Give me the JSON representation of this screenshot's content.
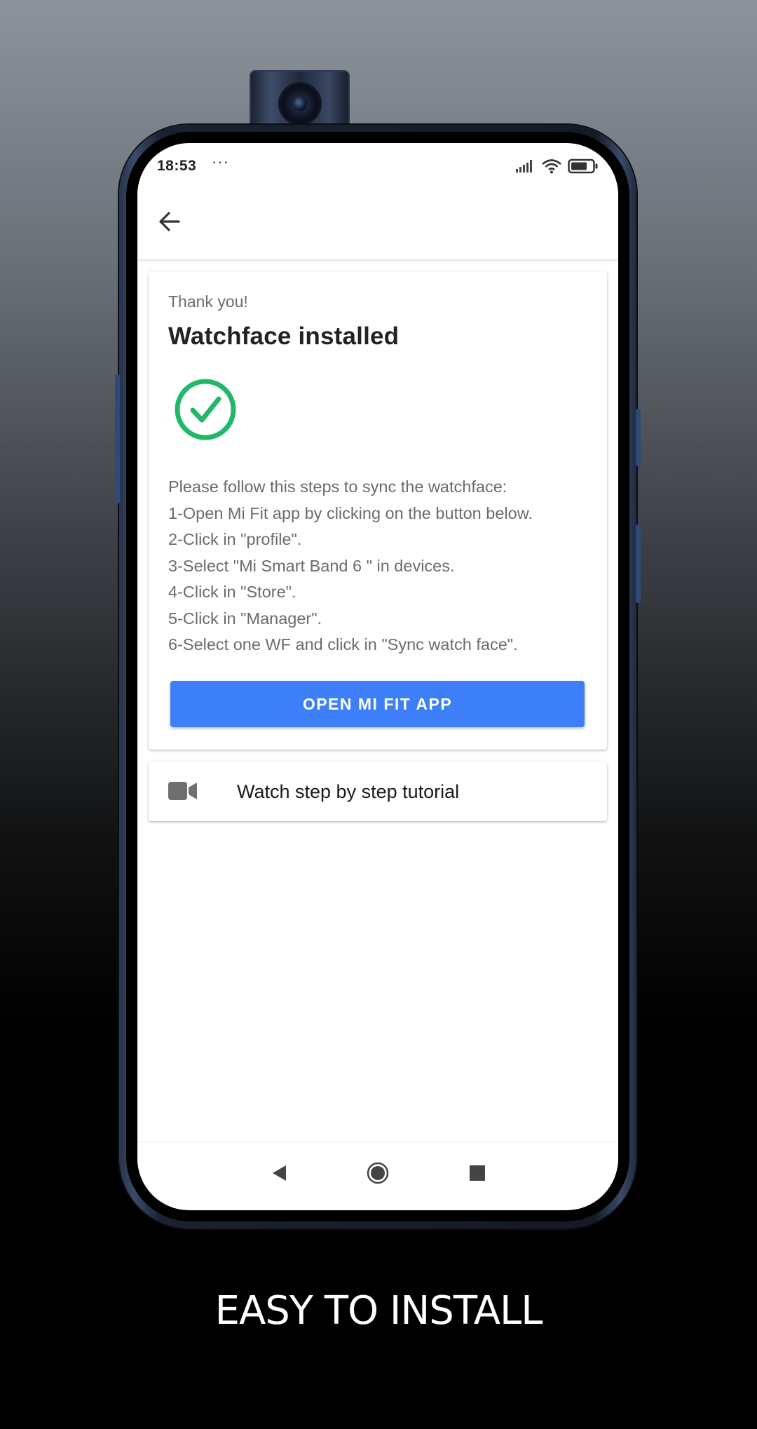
{
  "status_bar": {
    "time": "18:53",
    "dots": "···",
    "icons": [
      "signal-icon",
      "wifi-icon",
      "battery-icon"
    ]
  },
  "app_bar": {
    "back_icon": "arrow-left-icon"
  },
  "install_card": {
    "overline": "Thank you!",
    "title": "Watchface installed",
    "status_icon": "check-circle-icon",
    "status_color": "#21b86a",
    "steps": [
      "Please follow this steps to sync the watchface:",
      "1-Open Mi Fit app by clicking on the button below.",
      "2-Click in \"profile\".",
      "3-Select \"Mi Smart Band 6 \" in devices.",
      "4-Click in \"Store\".",
      "5-Click in \"Manager\".",
      "6-Select one WF and click in \"Sync watch face\"."
    ],
    "button_label": "OPEN MI FIT APP",
    "button_color": "#3d7ff8"
  },
  "tutorial_card": {
    "icon": "video-camera-icon",
    "label": "Watch step by step tutorial"
  },
  "nav_bar": {
    "buttons": [
      "back-triangle-icon",
      "home-circle-icon",
      "recents-square-icon"
    ]
  },
  "footer": {
    "caption": "EASY TO INSTALL"
  }
}
